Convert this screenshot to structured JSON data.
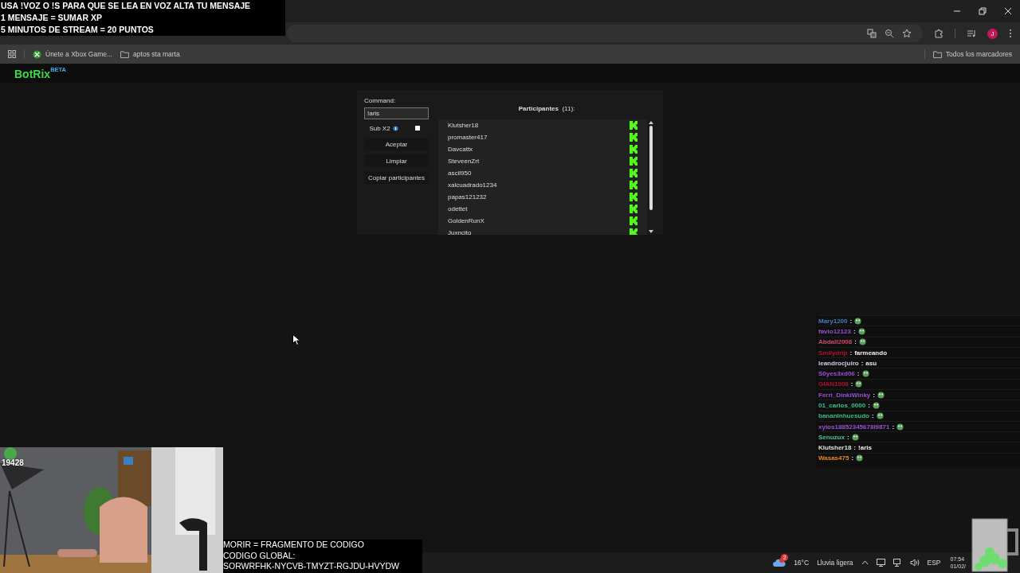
{
  "overlay_top": {
    "lines": [
      "USA !VOZ O !S PARA QUE SE LEA EN VOZ ALTA TU MENSAJE",
      "1 MENSAJE = SUMAR XP",
      "5 MINUTOS DE STREAM = 20 PUNTOS"
    ]
  },
  "browser": {
    "bookmarks": [
      {
        "label": "Únete a Xbox Game...",
        "kind": "xbox"
      },
      {
        "label": "aptos sta marta",
        "kind": "folder"
      }
    ],
    "all_bookmarks": "Todos los marcadores",
    "profile_initial": "J"
  },
  "app": {
    "logo": "BotRix",
    "logo_badge": "BETA",
    "command_label": "Command:",
    "command_value": "!aris",
    "sub_x2": {
      "label": "Sub X2",
      "checked": false
    },
    "buttons": [
      "Aceptar",
      "Limpiar",
      "Copiar participantes"
    ],
    "participants_title": "Participantes",
    "participants_count": "(11):",
    "participants": [
      "Klutsher18",
      "promaster417",
      "Davcattx",
      "SteveenZrt",
      "ascil950",
      "xalcuadrado1234",
      "papas121232",
      "odettet",
      "GoldenRunX",
      "Juxncito"
    ]
  },
  "chat": [
    {
      "user": "Mary1200",
      "color": "#3d7fc4",
      "separator": ":",
      "kind": "emote"
    },
    {
      "user": "favio12123",
      "color": "#9a4fd6",
      "separator": ":",
      "kind": "emote"
    },
    {
      "user": "Abdall2008",
      "color": "#d04a6b",
      "separator": ":",
      "kind": "emote"
    },
    {
      "user": "Smilydrip",
      "color": "#b0102a",
      "separator": ":",
      "kind": "text",
      "text": "farmeando"
    },
    {
      "user": "leandrocjuiro",
      "color": "#c8d0e0",
      "separator": ":",
      "kind": "text",
      "text": "asu"
    },
    {
      "user": "S0yes3xd06",
      "color": "#9a4fd6",
      "separator": ":",
      "kind": "emote"
    },
    {
      "user": "GIAN1908",
      "color": "#b0102a",
      "separator": ":",
      "kind": "emote"
    },
    {
      "user": "Ferri_DinkiWinky",
      "color": "#9a4fd6",
      "separator": ":",
      "kind": "emote"
    },
    {
      "user": "01_carlos_0000",
      "color": "#3fbf8f",
      "separator": ":",
      "kind": "emote"
    },
    {
      "user": "bananinhuesudo",
      "color": "#2fbf7f",
      "separator": ":",
      "kind": "emote"
    },
    {
      "user": "xylos18852345678l9871",
      "color": "#9a4fd6",
      "separator": ":",
      "kind": "emote"
    },
    {
      "user": "Senuzux",
      "color": "#4fc0a0",
      "separator": ":",
      "kind": "emote"
    },
    {
      "user": "Klutsher18",
      "color": "#e0e0e0",
      "separator": ":",
      "kind": "text",
      "text": "!aris"
    },
    {
      "user": "Wasas475",
      "color": "#e08a20",
      "separator": ":",
      "kind": "emote"
    }
  ],
  "webcam": {
    "kind": "picture",
    "counter": "19428"
  },
  "code_overlay": {
    "lines": [
      "MORIR = FRAGMENTO DE CODIGO",
      "CODIGO GLOBAL:",
      "SORWRFHK-NYCVB-TMYZT-RGJDU-HVYDW"
    ]
  },
  "taskbar": {
    "weather_badge": "2",
    "temperature": "16°C",
    "weather": "Lluvia ligera",
    "language": "ESP",
    "time": "07:54",
    "date": "01/02/"
  }
}
